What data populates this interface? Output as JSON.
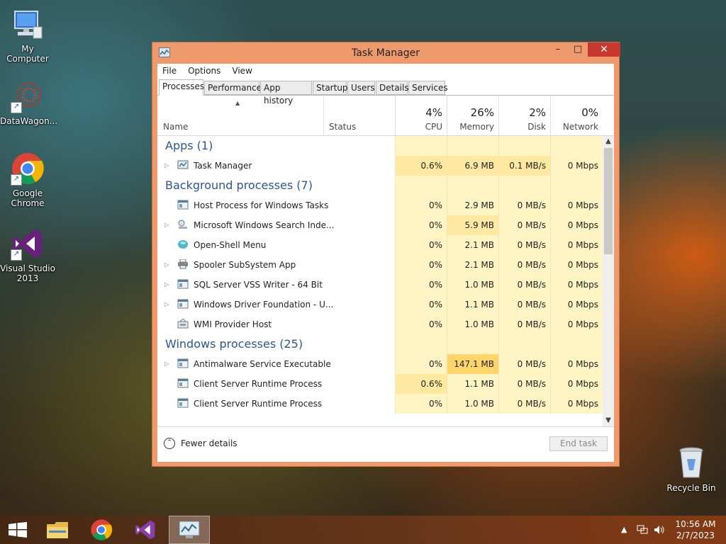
{
  "desktop": {
    "icons": [
      {
        "label": "My Computer",
        "icon": "computer-icon"
      },
      {
        "label": "DataWagon...",
        "icon": "datawagon-icon"
      },
      {
        "label": "Google Chrome",
        "icon": "chrome-icon"
      },
      {
        "label": "Visual Studio 2013",
        "icon": "visual-studio-icon"
      },
      {
        "label": "Recycle Bin",
        "icon": "recycle-bin-icon"
      }
    ]
  },
  "window": {
    "title": "Task Manager",
    "controls": {
      "minimize": "–",
      "maximize": "□",
      "close": "✕"
    },
    "menu": [
      "File",
      "Options",
      "View"
    ],
    "tabs": [
      "Processes",
      "Performance",
      "App history",
      "Startup",
      "Users",
      "Details",
      "Services"
    ],
    "active_tab": "Processes",
    "columns": {
      "name": "Name",
      "status": "Status",
      "cpu": {
        "pct": "4%",
        "label": "CPU"
      },
      "memory": {
        "pct": "26%",
        "label": "Memory"
      },
      "disk": {
        "pct": "2%",
        "label": "Disk"
      },
      "network": {
        "pct": "0%",
        "label": "Network"
      }
    },
    "groups": {
      "apps": {
        "title": "Apps (1)",
        "rows": [
          {
            "name": "Task Manager",
            "cpu": "0.6%",
            "memory": "6.9 MB",
            "disk": "0.1 MB/s",
            "network": "0 Mbps",
            "expandable": true
          }
        ]
      },
      "background": {
        "title": "Background processes (7)",
        "rows": [
          {
            "name": "Host Process for Windows Tasks",
            "cpu": "0%",
            "memory": "2.9 MB",
            "disk": "0 MB/s",
            "network": "0 Mbps",
            "expandable": false
          },
          {
            "name": "Microsoft Windows Search Inde...",
            "cpu": "0%",
            "memory": "5.9 MB",
            "disk": "0 MB/s",
            "network": "0 Mbps",
            "expandable": true
          },
          {
            "name": "Open-Shell Menu",
            "cpu": "0%",
            "memory": "2.1 MB",
            "disk": "0 MB/s",
            "network": "0 Mbps",
            "expandable": false
          },
          {
            "name": "Spooler SubSystem App",
            "cpu": "0%",
            "memory": "2.1 MB",
            "disk": "0 MB/s",
            "network": "0 Mbps",
            "expandable": true
          },
          {
            "name": "SQL Server VSS Writer - 64 Bit",
            "cpu": "0%",
            "memory": "1.0 MB",
            "disk": "0 MB/s",
            "network": "0 Mbps",
            "expandable": true
          },
          {
            "name": "Windows Driver Foundation - U...",
            "cpu": "0%",
            "memory": "1.1 MB",
            "disk": "0 MB/s",
            "network": "0 Mbps",
            "expandable": true
          },
          {
            "name": "WMI Provider Host",
            "cpu": "0%",
            "memory": "1.0 MB",
            "disk": "0 MB/s",
            "network": "0 Mbps",
            "expandable": false
          }
        ]
      },
      "windows": {
        "title": "Windows processes (25)",
        "rows": [
          {
            "name": "Antimalware Service Executable",
            "cpu": "0%",
            "memory": "147.1 MB",
            "disk": "0 MB/s",
            "network": "0 Mbps",
            "expandable": true
          },
          {
            "name": "Client Server Runtime Process",
            "cpu": "0.6%",
            "memory": "1.1 MB",
            "disk": "0 MB/s",
            "network": "0 Mbps",
            "expandable": false
          },
          {
            "name": "Client Server Runtime Process",
            "cpu": "0%",
            "memory": "1.0 MB",
            "disk": "0 MB/s",
            "network": "0 Mbps",
            "expandable": false
          }
        ]
      }
    },
    "footer": {
      "fewer_details": "Fewer details",
      "end_task": "End task"
    }
  },
  "taskbar": {
    "buttons": [
      "start-icon",
      "file-explorer-icon",
      "chrome-icon",
      "visual-studio-icon",
      "task-manager-icon"
    ],
    "clock": {
      "time": "10:56 AM",
      "date": "2/7/2023"
    }
  },
  "colors": {
    "window_frame": "#ee9a6d",
    "close_button": "#c7382e",
    "group_title": "#2b5797",
    "heat_low": "#fff4c4",
    "heat_mid": "#ffe9a0",
    "heat_high": "#ffd46b"
  }
}
